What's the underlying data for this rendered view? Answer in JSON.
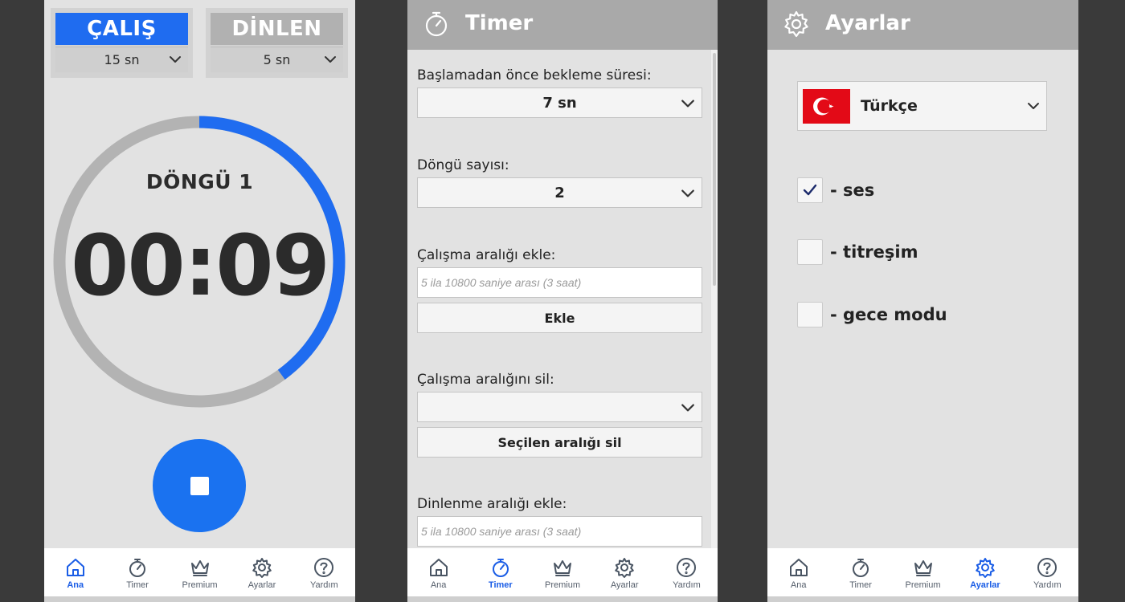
{
  "nav": [
    {
      "label": "Ana",
      "icon": "home-icon"
    },
    {
      "label": "Timer",
      "icon": "stopwatch-icon"
    },
    {
      "label": "Premium",
      "icon": "crown-icon"
    },
    {
      "label": "Ayarlar",
      "icon": "gear-icon"
    },
    {
      "label": "Yardım",
      "icon": "help-icon"
    }
  ],
  "main": {
    "work": {
      "label": "ÇALIŞ",
      "duration": "15 sn"
    },
    "rest": {
      "label": "DİNLEN",
      "duration": "5 sn"
    },
    "cycle": "DÖNGÜ 1",
    "time": "00:09",
    "progress": 0.4,
    "colors": {
      "accent": "#1f6cf0",
      "track": "#b3b3b3"
    }
  },
  "timer": {
    "title": "Timer",
    "wait_label": "Başlamadan önce bekleme süresi:",
    "wait_value": "7 sn",
    "cycles_label": "Döngü sayısı:",
    "cycles_value": "2",
    "add_work_label": "Çalışma aralığı ekle:",
    "add_work_placeholder": "5 ila 10800 saniye arası (3 saat)",
    "add_button": "Ekle",
    "remove_work_label": "Çalışma aralığını sil:",
    "remove_work_value": "",
    "remove_button": "Seçilen aralığı sil",
    "add_rest_label": "Dinlenme aralığı ekle:",
    "add_rest_placeholder": "5 ila 10800 saniye arası (3 saat)"
  },
  "settings": {
    "title": "Ayarlar",
    "language": "Türkçe",
    "options": [
      {
        "label": "- ses",
        "checked": true
      },
      {
        "label": "- titreşim",
        "checked": false
      },
      {
        "label": "- gece modu",
        "checked": false
      }
    ]
  }
}
